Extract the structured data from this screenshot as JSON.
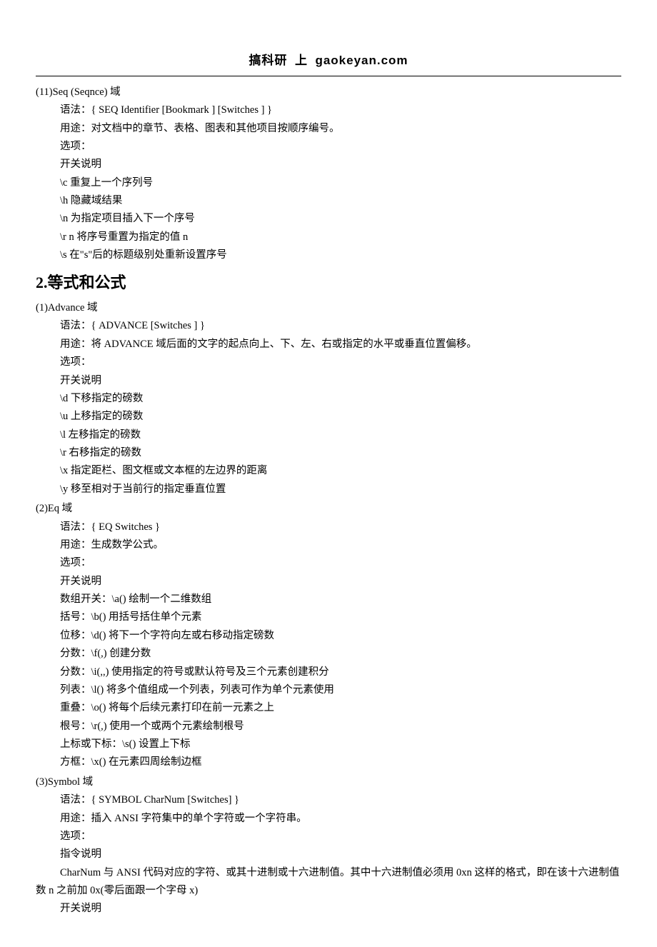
{
  "header": {
    "text1": "搞科研",
    "text2": "上",
    "site": "gaokeyan.com"
  },
  "sections": [
    {
      "title": "(11)Seq (Seqnce) 域",
      "lines": [
        "语法：{ SEQ Identifier [Bookmark ] [Switches ] }",
        "用途：对文档中的章节、表格、图表和其他项目按顺序编号。",
        "选项：",
        "开关说明",
        "\\c 重复上一个序列号",
        "\\h 隐藏域结果",
        "\\n 为指定项目插入下一个序号",
        "\\r n 将序号重置为指定的值 n",
        "\\s 在\"s\"后的标题级别处重新设置序号"
      ]
    }
  ],
  "heading2": "2.等式和公式",
  "sections2": [
    {
      "title": "(1)Advance 域",
      "lines": [
        "语法：{ ADVANCE [Switches ] }",
        "用途：将 ADVANCE 域后面的文字的起点向上、下、左、右或指定的水平或垂直位置偏移。",
        "选项：",
        "开关说明",
        "\\d 下移指定的磅数",
        "\\u 上移指定的磅数",
        "\\l 左移指定的磅数",
        "\\r 右移指定的磅数",
        "\\x 指定距栏、图文框或文本框的左边界的距离",
        "\\y 移至相对于当前行的指定垂直位置"
      ]
    },
    {
      "title": "(2)Eq 域",
      "lines": [
        "语法：{ EQ Switches }",
        "用途：生成数学公式。",
        "选项：",
        "开关说明",
        "数组开关：\\a() 绘制一个二维数组",
        "括号：\\b() 用括号括住单个元素",
        "位移：\\d() 将下一个字符向左或右移动指定磅数",
        "分数：\\f(,) 创建分数",
        "分数：\\i(,,) 使用指定的符号或默认符号及三个元素创建积分",
        "列表：\\l() 将多个值组成一个列表，列表可作为单个元素使用",
        "重叠：\\o() 将每个后续元素打印在前一元素之上",
        "根号：\\r(,) 使用一个或两个元素绘制根号",
        "上标或下标：\\s() 设置上下标",
        "方框：\\x() 在元素四周绘制边框"
      ]
    },
    {
      "title": "(3)Symbol 域",
      "lines": [
        "语法：{ SYMBOL CharNum [Switches] }",
        "用途：插入 ANSI 字符集中的单个字符或一个字符串。",
        "选项：",
        "指令说明"
      ],
      "wraplines": [
        "CharNum 与 ANSI 代码对应的字符、或其十进制或十六进制值。其中十六进制值必须用 0xn 这样的格式，即在该十六进制值数 n 之前加 0x(零后面跟一个字母 x)"
      ],
      "taillines": [
        "开关说明"
      ]
    }
  ]
}
